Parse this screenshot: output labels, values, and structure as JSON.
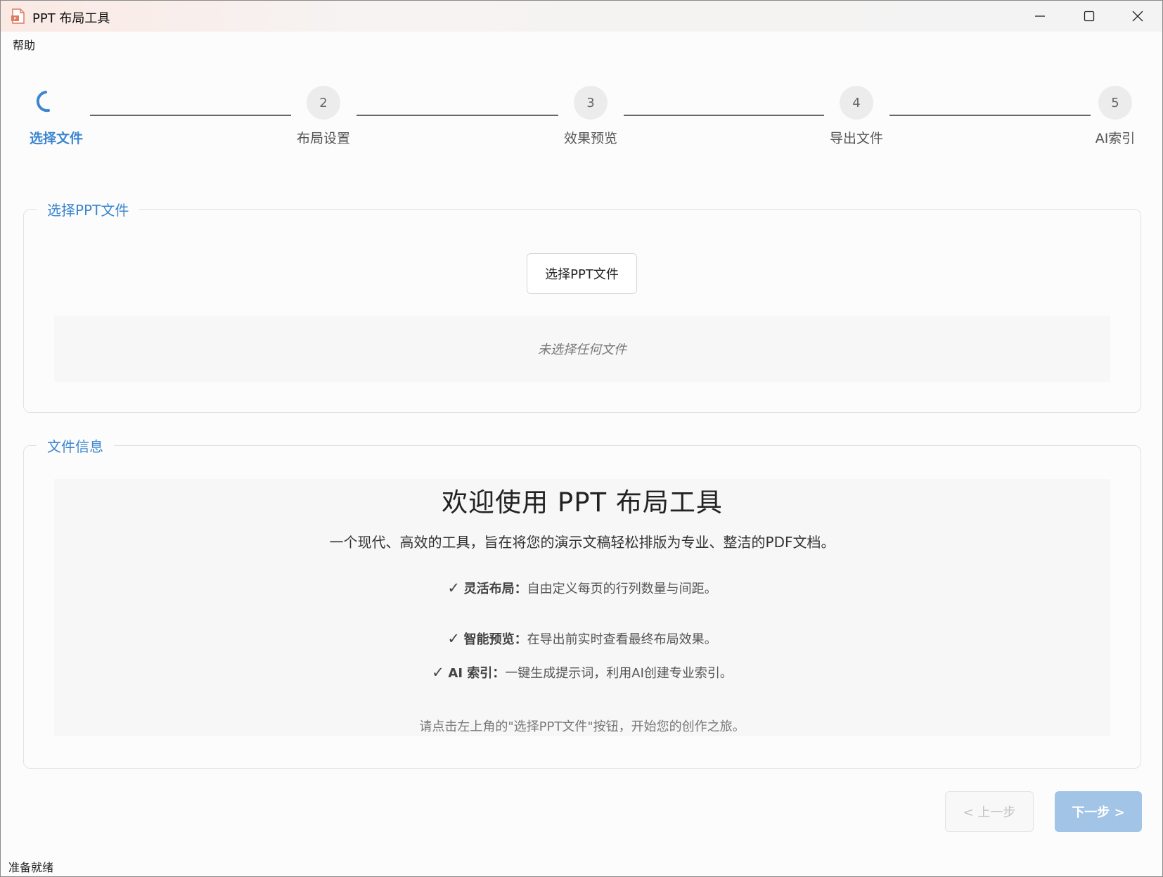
{
  "window": {
    "title": "PPT 布局工具",
    "icon": "ppt-file-icon",
    "controls": [
      "minimize-icon",
      "maximize-icon",
      "close-icon"
    ]
  },
  "menu": {
    "help": "帮助"
  },
  "stepper": {
    "steps": [
      {
        "number": "",
        "label": "选择文件",
        "state": "active"
      },
      {
        "number": "2",
        "label": "布局设置",
        "state": "pending"
      },
      {
        "number": "3",
        "label": "效果预览",
        "state": "pending"
      },
      {
        "number": "4",
        "label": "导出文件",
        "state": "pending"
      },
      {
        "number": "5",
        "label": "AI索引",
        "state": "pending"
      }
    ]
  },
  "select_group": {
    "title": "选择PPT文件",
    "button_label": "选择PPT文件",
    "empty_text": "未选择任何文件"
  },
  "info_group": {
    "title": "文件信息",
    "welcome_title": "欢迎使用 PPT 布局工具",
    "subtitle": "一个现代、高效的工具，旨在将您的演示文稿轻松排版为专业、整洁的PDF文档。",
    "features": [
      {
        "check": "✓",
        "name": "灵活布局：",
        "desc": "自由定义每页的行列数量与间距。"
      },
      {
        "check": "✓",
        "name": "智能预览：",
        "desc": "在导出前实时查看最终布局效果。"
      },
      {
        "check": "✓",
        "name": "AI 索引：",
        "desc": "一键生成提示词，利用AI创建专业索引。"
      }
    ],
    "hint": "请点击左上角的\"选择PPT文件\"按钮，开始您的创作之旅。"
  },
  "nav": {
    "prev_label": "< 上一步",
    "next_label": "下一步 >"
  },
  "status": "准备就绪",
  "colors": {
    "accent": "#3b86d0",
    "next_button": "#a2c4e6",
    "step_circle": "#ececec",
    "panel_bg": "#f7f7f7"
  }
}
